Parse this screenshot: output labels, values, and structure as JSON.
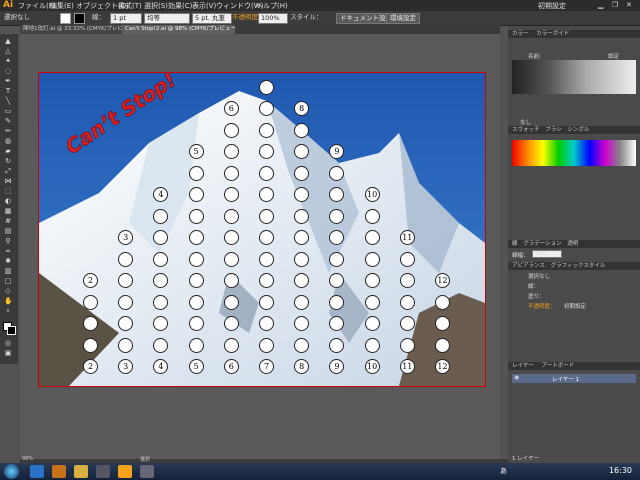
{
  "app": {
    "logo": "Ai",
    "workspace": "初期設定"
  },
  "menu": [
    "ファイル(F)",
    "編集(E)",
    "オブジェクト(O)",
    "書式(T)",
    "選択(S)",
    "効果(C)",
    "表示(V)",
    "ウィンドウ(W)",
    "ヘルプ(H)"
  ],
  "control": {
    "selection": "選択なし",
    "stroke_label": "線：",
    "stroke_weight": "1 pt",
    "stroke_style": "均等",
    "brush": "5 pt. 丸筆",
    "opacity_label": "不透明度",
    "opacity": "100%",
    "style_label": "スタイル：",
    "doc_settings": "ドキュメント設定",
    "prefs": "環境設定"
  },
  "tabs": [
    "陣地1改訂.ai @ 33.33% (CMYK/プレビュー)",
    "Can't Stop!2.ai @ 98% (CMYK/プレビュー)"
  ],
  "artwork": {
    "title": "Can’t Stop!",
    "columns": [
      {
        "n": "2",
        "cells": 3
      },
      {
        "n": "3",
        "cells": 5
      },
      {
        "n": "4",
        "cells": 7
      },
      {
        "n": "5",
        "cells": 9
      },
      {
        "n": "6",
        "cells": 11
      },
      {
        "n": "7",
        "cells": 13
      },
      {
        "n": "8",
        "cells": 11
      },
      {
        "n": "9",
        "cells": 9
      },
      {
        "n": "10",
        "cells": 7
      },
      {
        "n": "11",
        "cells": 5
      },
      {
        "n": "12",
        "cells": 3
      }
    ]
  },
  "panels": {
    "color_tabs": [
      "カラー",
      "カラーガイド"
    ],
    "guide_left": "名前:",
    "guide_right": "設定",
    "swatch_tabs": [
      "スウォッチ",
      "ブラシ",
      "シンボル"
    ],
    "none_label": "なし",
    "appearance_tabs": [
      "線",
      "グラデーション",
      "透明"
    ],
    "stroke_weight_label": "線幅：",
    "stroke_weight_value": "1 pt",
    "appearance_title": "アピアランス",
    "graphic_style": "グラフィックスタイル",
    "no_selection": "選択なし",
    "row_stroke": "線：",
    "row_fill": "塗り：",
    "row_opacity": "不透明度：",
    "row_opacity_value": "初期設定",
    "layers_tab": "レイヤー",
    "artboard_tab": "アートボード",
    "layer_name": "レイヤー 1",
    "layer_count": "1 レイヤー"
  },
  "status": {
    "zoom": "98%",
    "tool": "選択"
  },
  "taskbar": {
    "time": "16:30",
    "lang": "あ"
  }
}
